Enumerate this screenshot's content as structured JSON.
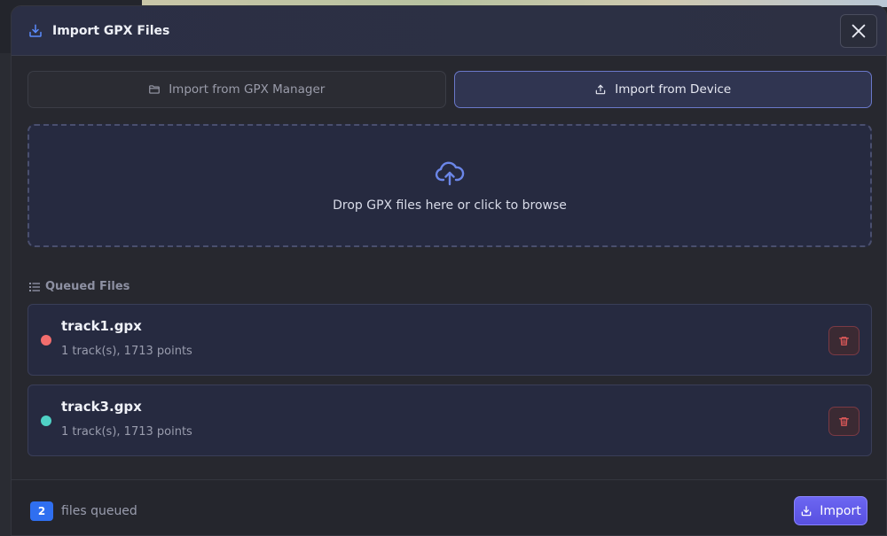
{
  "modal": {
    "title": "Import GPX Files",
    "header_icon": "import-icon",
    "close_icon": "close-icon"
  },
  "tabs": [
    {
      "label": "Import from GPX Manager",
      "icon": "folder-icon",
      "active": false
    },
    {
      "label": "Import from Device",
      "icon": "upload-icon",
      "active": true
    }
  ],
  "dropzone": {
    "icon": "cloud-upload-icon",
    "text": "Drop GPX files here or click to browse"
  },
  "queue": {
    "label": "Queued Files",
    "icon": "list-icon",
    "files": [
      {
        "name": "track1.gpx",
        "meta": "1 track(s), 1713 points",
        "color": "#f26d6d"
      },
      {
        "name": "track3.gpx",
        "meta": "1 track(s), 1713 points",
        "color": "#4fd1c5"
      }
    ]
  },
  "footer": {
    "count": "2",
    "count_label": "files queued",
    "import_label": "Import",
    "import_icon": "import-icon"
  },
  "colors": {
    "accent": "#5b8cff",
    "primary_button": "#6c66f2",
    "danger": "#e05a5a"
  }
}
